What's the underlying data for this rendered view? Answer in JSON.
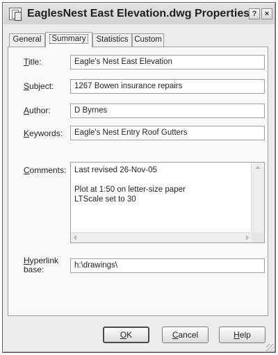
{
  "window": {
    "title": "EaglesNest East Elevation.dwg Properties",
    "help_glyph": "?",
    "close_glyph": "×"
  },
  "tabs": [
    {
      "label": "General",
      "active": false
    },
    {
      "label": "Summary",
      "active": true
    },
    {
      "label": "Statistics",
      "active": false
    },
    {
      "label": "Custom",
      "active": false
    }
  ],
  "summary": {
    "title": {
      "label_key": "T",
      "label_rest": "itle:",
      "value": "Eagle's Nest East Elevation"
    },
    "subject": {
      "label_key": "S",
      "label_rest": "ubject:",
      "value": "1267 Bowen insurance repairs"
    },
    "author": {
      "label_key": "A",
      "label_rest": "uthor:",
      "value": "D Byrnes"
    },
    "keywords": {
      "label_key": "K",
      "label_rest": "eywords:",
      "value": "Eagle's Nest Entry Roof Gutters"
    },
    "comments": {
      "label_key": "C",
      "label_rest": "omments:",
      "value": "Last revised 26-Nov-05\n\nPlot at 1:50 on letter-size paper\nLTScale set to 30"
    },
    "hyperlink": {
      "label_line1_key": "H",
      "label_line1_rest": "yperlink",
      "label_line2": "base:",
      "value": "h:\\drawings\\"
    }
  },
  "buttons": {
    "ok": {
      "key": "O",
      "rest": "K"
    },
    "cancel": {
      "key": "C",
      "rest": "ancel"
    },
    "help": {
      "key": "H",
      "rest": "elp"
    }
  }
}
